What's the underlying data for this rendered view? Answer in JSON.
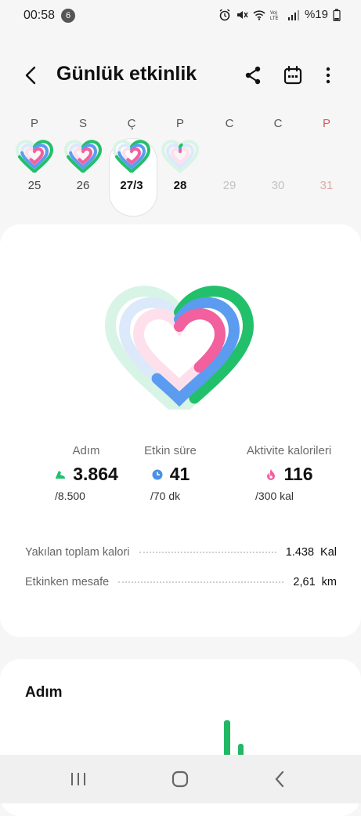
{
  "status_bar": {
    "time": "00:58",
    "notification_count": "6",
    "battery": "%19"
  },
  "header": {
    "title": "Günlük etkinlik"
  },
  "week": [
    {
      "letter": "P",
      "num": "25",
      "state": "past"
    },
    {
      "letter": "S",
      "num": "26",
      "state": "past"
    },
    {
      "letter": "Ç",
      "num": "27/3",
      "state": "selected"
    },
    {
      "letter": "P",
      "num": "28",
      "state": "today"
    },
    {
      "letter": "C",
      "num": "29",
      "state": "future"
    },
    {
      "letter": "C",
      "num": "30",
      "state": "future"
    },
    {
      "letter": "P",
      "num": "31",
      "state": "future-red"
    }
  ],
  "activity": {
    "steps": {
      "label": "Adım",
      "value": "3.864",
      "goal": "/8.500",
      "progress": 0.45,
      "color": "#22c06a"
    },
    "active": {
      "label": "Etkin süre",
      "value": "41",
      "goal": "/70 dk",
      "progress": 0.59,
      "color": "#5b9cf0"
    },
    "calories": {
      "label": "Aktivite kalorileri",
      "value": "116",
      "goal": "/300 kal",
      "progress": 0.39,
      "color": "#f2609e"
    }
  },
  "details": [
    {
      "label": "Yakılan toplam kalori",
      "value": "1.438",
      "unit": "Kal"
    },
    {
      "label": "Etkinken mesafe",
      "value": "2,61",
      "unit": "km"
    }
  ],
  "steps_section": {
    "title": "Adım"
  },
  "icons": {
    "back": "back-arrow-icon",
    "share": "share-icon",
    "calendar": "calendar-icon",
    "more": "more-vertical-icon",
    "steps": "shoe-icon",
    "time": "clock-icon",
    "calories": "flame-icon",
    "nav_recent": "recent-apps-icon",
    "nav_home": "home-icon",
    "nav_back": "nav-back-icon"
  }
}
